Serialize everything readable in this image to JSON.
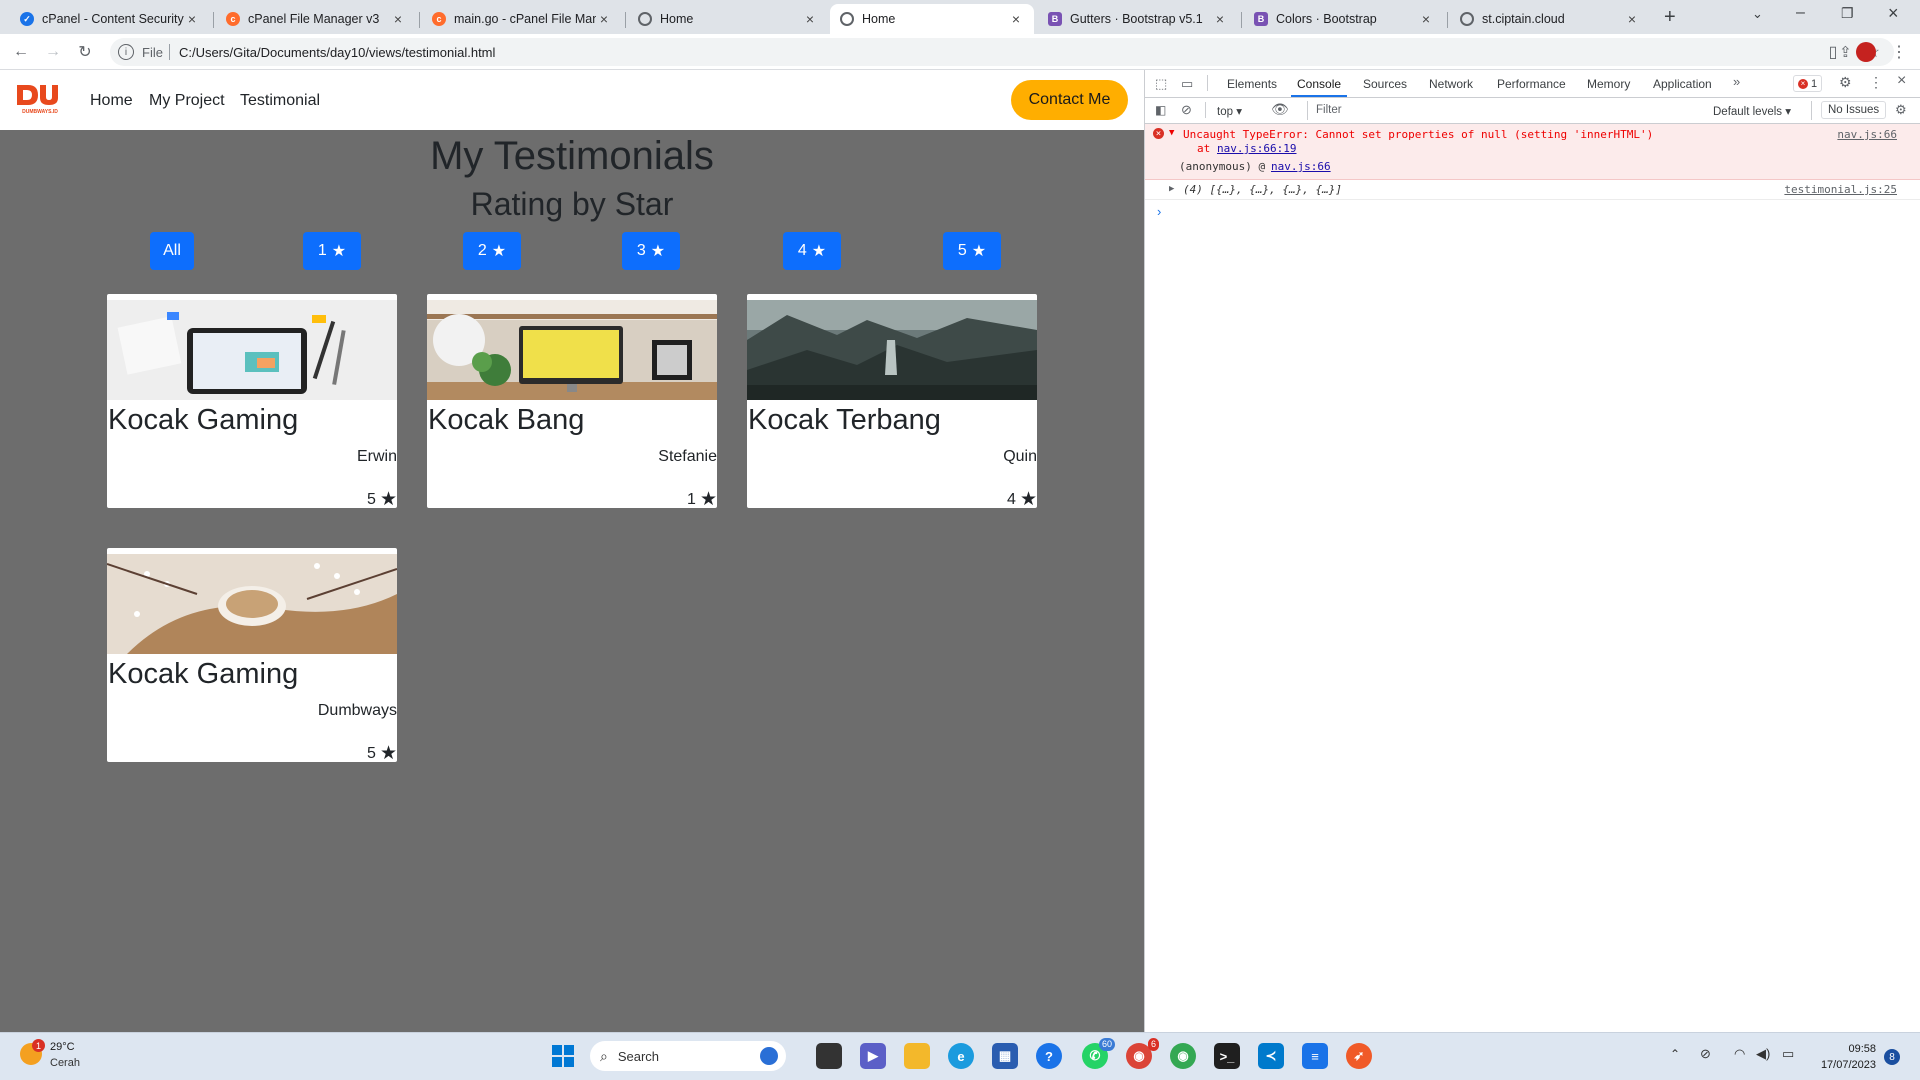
{
  "browser": {
    "tabs": [
      {
        "title": "cPanel - Content Security P",
        "icon": "cpanel-shield-icon",
        "color": "#1a73e8"
      },
      {
        "title": "cPanel File Manager v3",
        "icon": "cpanel-icon",
        "color": "#ff6c2c"
      },
      {
        "title": "main.go - cPanel File Mana",
        "icon": "cpanel-icon",
        "color": "#ff6c2c"
      },
      {
        "title": "Home",
        "icon": "globe-icon",
        "color": "#5f6368"
      },
      {
        "title": "Home",
        "icon": "globe-icon",
        "color": "#5f6368",
        "active": true
      },
      {
        "title": "Gutters · Bootstrap v5.1",
        "icon": "bootstrap-icon",
        "color": "#7952b3"
      },
      {
        "title": "Colors · Bootstrap",
        "icon": "bootstrap-icon",
        "color": "#7952b3"
      },
      {
        "title": "st.ciptain.cloud",
        "icon": "globe-icon",
        "color": "#5f6368"
      }
    ],
    "new_tab": "+",
    "url_scheme": "File",
    "url": "C:/Users/Gita/Documents/day10/views/testimonial.html"
  },
  "site": {
    "logo_text": "DUMBWAYS.ID",
    "nav": [
      "Home",
      "My Project",
      "Testimonial"
    ],
    "contact": "Contact Me",
    "title": "My Testimonials",
    "subtitle": "Rating by Star",
    "filters": [
      "All",
      "1",
      "2",
      "3",
      "4",
      "5"
    ],
    "cards": [
      {
        "title": "Kocak Gaming",
        "author": "Erwin",
        "rating": "5",
        "image": "tablet-desk-photo"
      },
      {
        "title": "Kocak Bang",
        "author": "Stefanie",
        "rating": "1",
        "image": "desk-computer-photo"
      },
      {
        "title": "Kocak Terbang",
        "author": "Quin",
        "rating": "4",
        "image": "mountain-valley-photo"
      },
      {
        "title": "Kocak Gaming",
        "author": "Dumbways",
        "rating": "5",
        "image": "coffee-flowers-photo"
      }
    ]
  },
  "devtools": {
    "tabs": [
      "Elements",
      "Console",
      "Sources",
      "Network",
      "Performance",
      "Memory",
      "Application"
    ],
    "active_tab": "Console",
    "error_count": "1",
    "context": "top",
    "filter_placeholder": "Filter",
    "levels": "Default levels",
    "issues": "No Issues",
    "error": {
      "message": "Uncaught TypeError: Cannot set properties of null (setting 'innerHTML')",
      "at": "at",
      "at_link": "nav.js:66:19",
      "anon": "(anonymous) @",
      "anon_link": "nav.js:66",
      "source": "nav.js:66"
    },
    "log": {
      "text": "(4) [{…}, {…}, {…}, {…}]",
      "source": "testimonial.js:25"
    },
    "prompt": "›"
  },
  "taskbar": {
    "weather_temp": "29°C",
    "weather_desc": "Cerah",
    "weather_badge": "1",
    "search": "Search",
    "whatsapp_badge": "60",
    "chrome_badge": "6",
    "time": "09:58",
    "date": "17/07/2023",
    "notif_count": "8"
  }
}
